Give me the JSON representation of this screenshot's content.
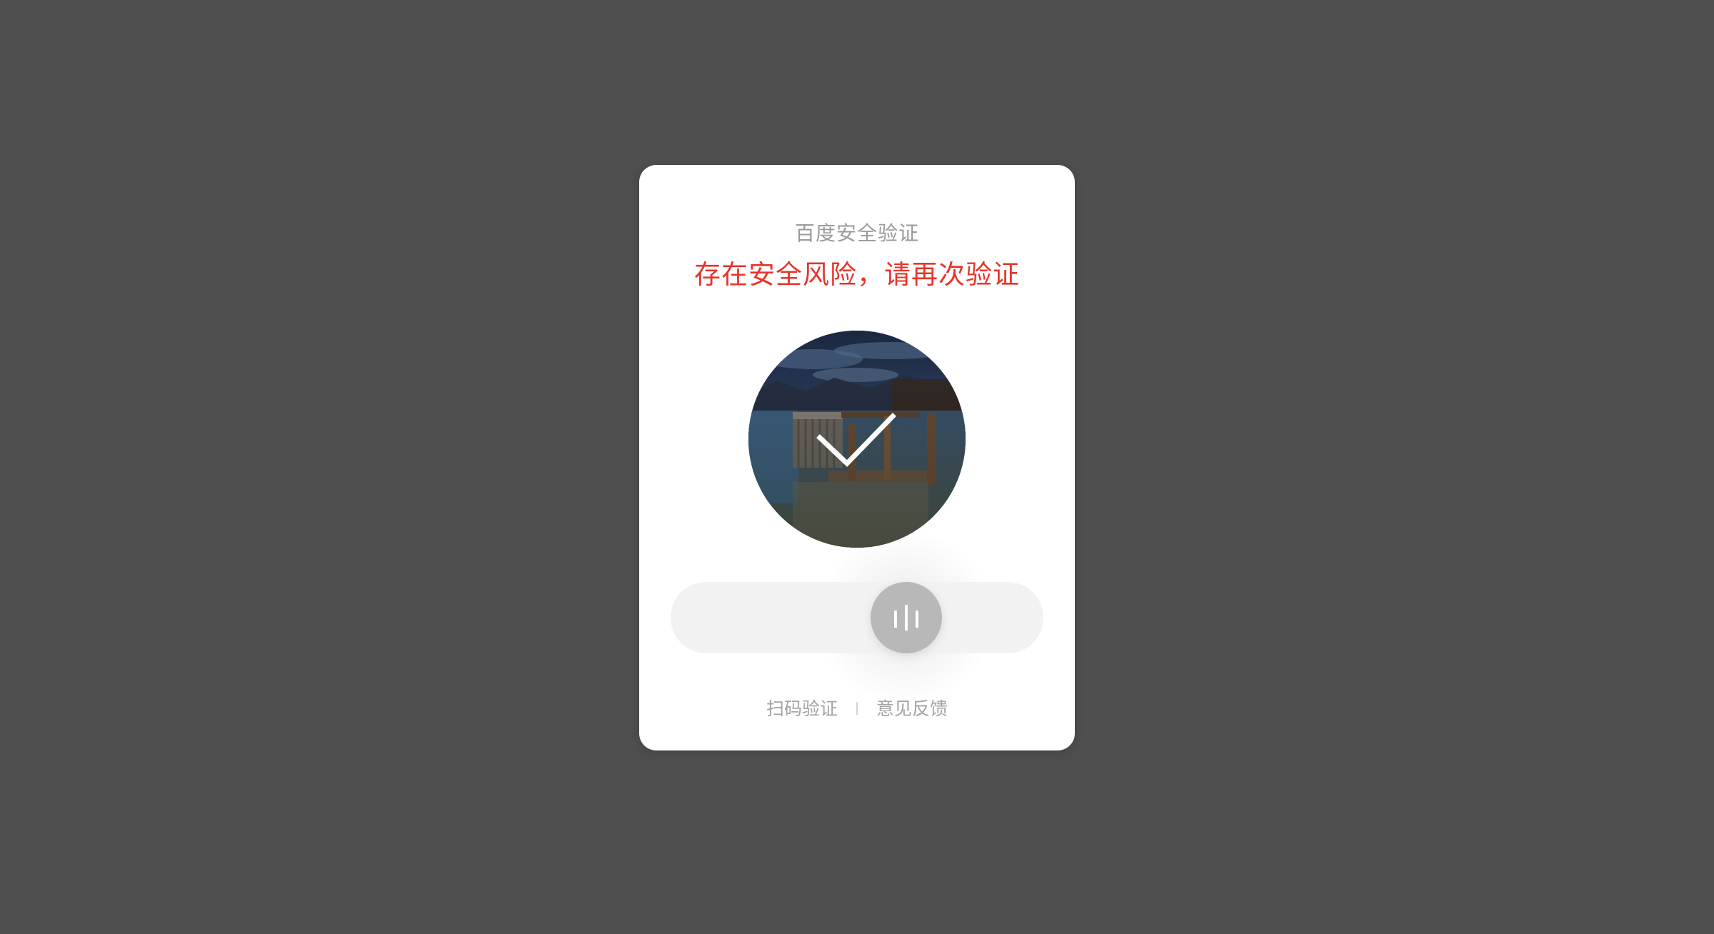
{
  "dialog": {
    "title": "百度安全验证",
    "warning": "存在安全风险，请再次验证",
    "image": {
      "description_icon": "rotated-photo-lake-boathouse",
      "status_icon": "checkmark-icon"
    },
    "slider": {
      "handle_icon": "drag-bars-icon"
    },
    "footer": {
      "scan_label": "扫码验证",
      "separator": "|",
      "feedback_label": "意见反馈"
    }
  },
  "colors": {
    "background": "#4e4e4e",
    "title": "#9a9a9a",
    "warning": "#e8342a",
    "track": "#f2f2f2",
    "handle": "#b8b8b8"
  }
}
